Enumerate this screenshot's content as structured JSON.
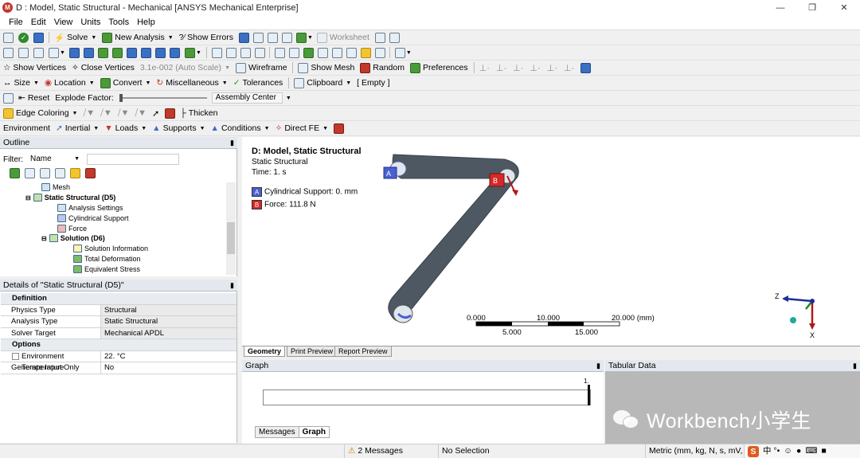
{
  "window": {
    "title": "D : Model, Static Structural - Mechanical [ANSYS Mechanical Enterprise]",
    "app_icon": "M"
  },
  "menu": [
    "File",
    "Edit",
    "View",
    "Units",
    "Tools",
    "Help"
  ],
  "toolbar1": {
    "solve": "Solve",
    "new_analysis": "New Analysis",
    "show_errors": "?⁄ Show Errors",
    "worksheet": "Worksheet"
  },
  "toolbar3": {
    "show_vertices": "Show Vertices",
    "close_vertices": "Close Vertices",
    "scale": "3.1e-002 (Auto Scale)",
    "wireframe": "Wireframe",
    "show_mesh": "Show Mesh",
    "random": "Random",
    "preferences": "Preferences"
  },
  "toolbar4": {
    "size": "Size",
    "location": "Location",
    "convert": "Convert",
    "miscellaneous": "Miscellaneous",
    "tolerances": "Tolerances",
    "clipboard": "Clipboard",
    "clipboard_value": "[ Empty ]"
  },
  "toolbar5": {
    "reset": "Reset",
    "explode_factor": "Explode Factor:",
    "assembly_center": "Assembly Center"
  },
  "toolbar6": {
    "edge_coloring": "Edge Coloring",
    "thicken": "Thicken"
  },
  "toolbar7": {
    "environment": "Environment",
    "inertial": "Inertial",
    "loads": "Loads",
    "supports": "Supports",
    "conditions": "Conditions",
    "direct_fe": "Direct FE"
  },
  "outline": {
    "header": "Outline",
    "filter_label": "Filter:",
    "filter_value": "Name",
    "tree": [
      "Mesh",
      "Static Structural (D5)",
      "Analysis Settings",
      "Cylindrical Support",
      "Force",
      "Solution (D6)",
      "Solution Information",
      "Total Deformation",
      "Equivalent Stress"
    ]
  },
  "details": {
    "header": "Details of \"Static Structural (D5)\"",
    "sections": [
      {
        "name": "Definition",
        "rows": [
          [
            "Physics Type",
            "Structural"
          ],
          [
            "Analysis Type",
            "Static Structural"
          ],
          [
            "Solver Target",
            "Mechanical APDL"
          ]
        ]
      },
      {
        "name": "Options",
        "rows": [
          [
            "Environment Temperature",
            "22. °C"
          ],
          [
            "Generate Input Only",
            "No"
          ]
        ]
      }
    ]
  },
  "viewport": {
    "title": "D: Model, Static Structural",
    "subtitle": "Static Structural",
    "time": "Time: 1. s",
    "legend": [
      {
        "letter": "A",
        "label": "Cylindrical Support: 0. mm",
        "color": "#4a5fd0"
      },
      {
        "letter": "B",
        "label": "Force: 111.8 N",
        "color": "#d62828"
      }
    ],
    "scale": {
      "top": [
        "0.000",
        "10.000",
        "20.000 (mm)"
      ],
      "bottom": [
        "5.000",
        "15.000"
      ]
    },
    "triad": {
      "z": "Z",
      "x": "X"
    }
  },
  "view_tabs": [
    "Geometry",
    "Print Preview",
    "Report Preview"
  ],
  "graph": {
    "header": "Graph",
    "tick": "1.",
    "tabs": [
      "Messages",
      "Graph"
    ]
  },
  "tabular": {
    "header": "Tabular Data",
    "watermark": "Workbench小学生"
  },
  "status": {
    "messages": "2 Messages",
    "selection": "No Selection",
    "units": "Metric (mm, kg, N, s, mV, mA)",
    "ime": "中 °•"
  }
}
